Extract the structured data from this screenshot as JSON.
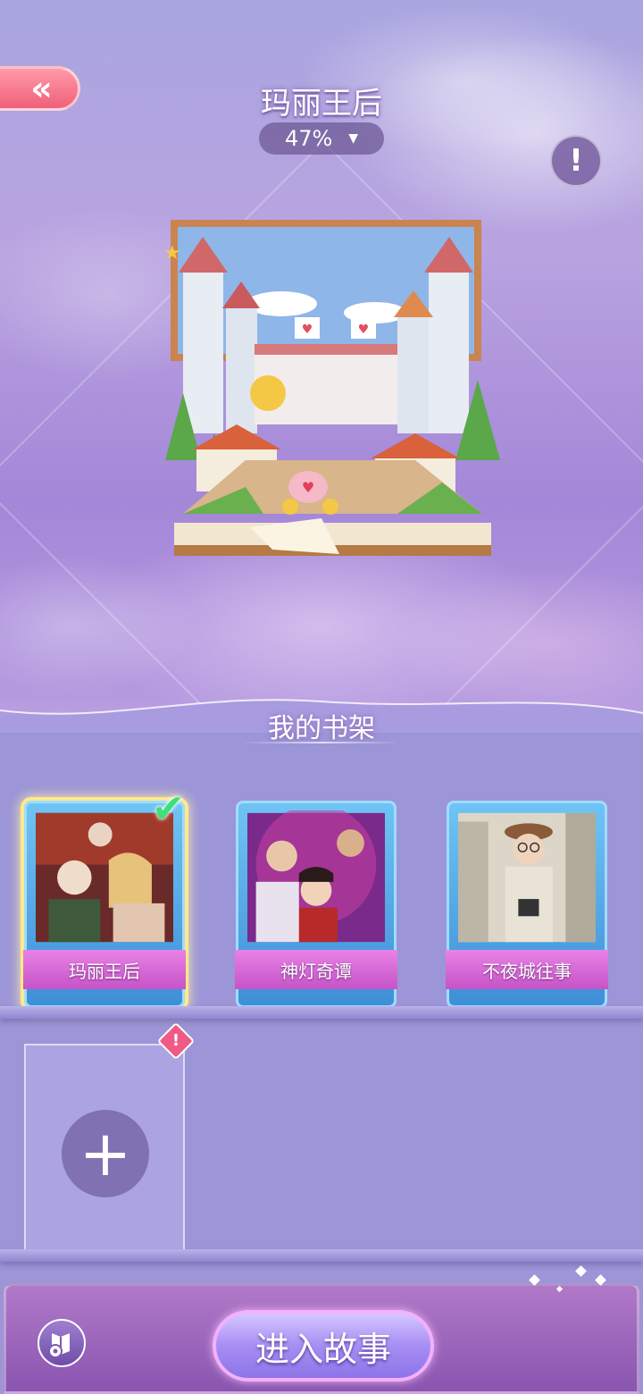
{
  "header": {
    "back_icon": "«",
    "book_title": "玛丽王后",
    "progress": "47%",
    "progress_caret": "▼",
    "info_icon": "!"
  },
  "shelf": {
    "title": "我的书架",
    "books": [
      {
        "title": "玛丽王后",
        "selected": true
      },
      {
        "title": "神灯奇谭",
        "selected": false
      },
      {
        "title": "不夜城往事",
        "selected": false
      }
    ],
    "add_icon": "+",
    "alert_icon": "!"
  },
  "footer": {
    "enter_label": "进入故事"
  },
  "colors": {
    "accent_pink": "#f0607a",
    "label_magenta": "#c653c8",
    "card_blue": "#3f8fd8",
    "check_green": "#3ee07a"
  }
}
